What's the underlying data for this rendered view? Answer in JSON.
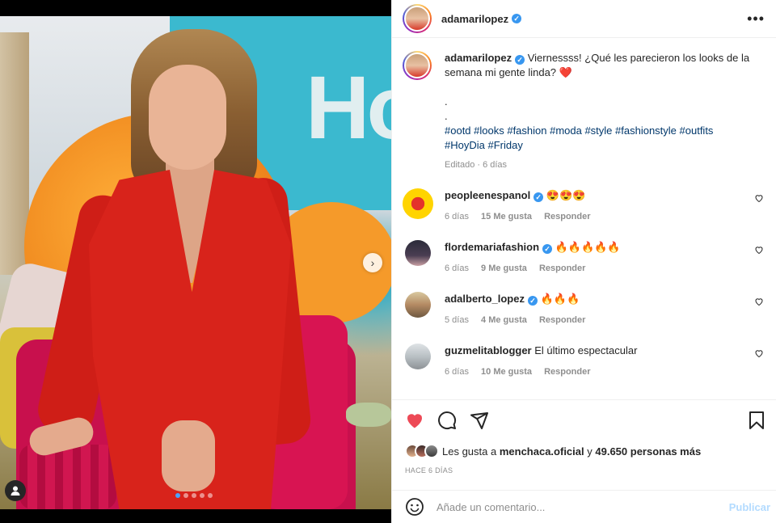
{
  "post": {
    "author": "adamarilopez",
    "verified_icon": "verified-badge-icon",
    "more_icon": "more-options-icon",
    "carousel": {
      "slide_count": 5,
      "active_index": 0
    }
  },
  "caption": {
    "username": "adamarilopez",
    "text": "Viernessss! ¿Qué les parecieron los looks de la semana mi gente linda? ❤️",
    "dot1": ".",
    "dot2": ".",
    "hashtags": "#ootd #looks #fashion #moda #style #fashionstyle #outfits #HoyDia #Friday",
    "edited": "Editado · 6 días"
  },
  "comments": [
    {
      "username": "peopleenespanol",
      "verified": true,
      "text": "😍😍😍",
      "age": "6 días",
      "likes": "15 Me gusta",
      "reply": "Responder"
    },
    {
      "username": "flordemariafashion",
      "verified": true,
      "text": "🔥🔥🔥🔥🔥",
      "age": "6 días",
      "likes": "9 Me gusta",
      "reply": "Responder"
    },
    {
      "username": "adalberto_lopez",
      "verified": true,
      "text": "🔥🔥🔥",
      "age": "5 días",
      "likes": "4 Me gusta",
      "reply": "Responder"
    },
    {
      "username": "guzmelitablogger",
      "verified": false,
      "text": "El último espectacular",
      "age": "6 días",
      "likes": "10 Me gusta",
      "reply": "Responder"
    }
  ],
  "actions": {
    "like_icon": "heart-filled-icon",
    "comment_icon": "comment-icon",
    "share_icon": "share-icon",
    "save_icon": "bookmark-icon",
    "liked_color": "#ed4956"
  },
  "likes": {
    "prefix": "Les gusta a",
    "user": "menchaca.oficial",
    "middle": "y",
    "others": "49.650 personas más"
  },
  "timestamp": "HACE 6 DÍAS",
  "add_comment": {
    "emoji_icon": "emoji-icon",
    "placeholder": "Añade un comentario...",
    "post_label": "Publicar"
  }
}
